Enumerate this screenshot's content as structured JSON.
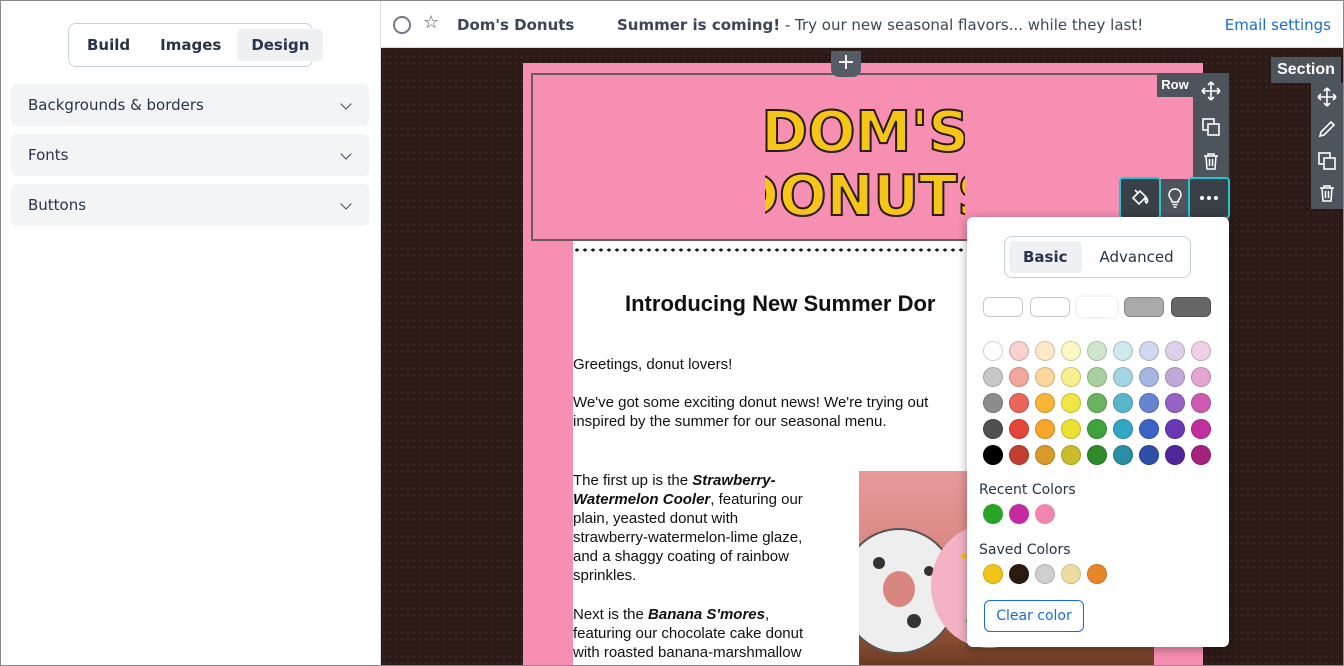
{
  "sidebar": {
    "tabs": [
      {
        "label": "Build",
        "active": false
      },
      {
        "label": "Images",
        "active": false
      },
      {
        "label": "Design",
        "active": true
      }
    ],
    "sections": [
      {
        "label": "Backgrounds & borders",
        "icon": "chevron-down-icon"
      },
      {
        "label": "Fonts",
        "icon": "chevron-down-icon"
      },
      {
        "label": "Buttons",
        "icon": "chevron-down-icon"
      }
    ]
  },
  "topbar": {
    "name": "Dom's Donuts",
    "subject_bold": "Summer is coming!",
    "subject_rest": " - Try our new seasonal flavors... while they last!",
    "email_settings": "Email settings"
  },
  "email": {
    "logo_line1": "DOM'S",
    "logo_line2": "DONUTS",
    "title": "Introducing New Summer Dor",
    "greeting": "Greetings, donut lovers!",
    "intro_line1": "We've got some exciting donut news! We're trying out",
    "intro_line2": "inspired by the summer for our seasonal menu.",
    "p1_pre": "The first up is the ",
    "p1_bold_a": "Strawberry-",
    "p1_bold_b": "Watermelon Cooler",
    "p1_rest_a": ", featuring our",
    "p1_line3": "plain, yeasted donut with",
    "p1_line4": "strawberry-watermelon-lime glaze,",
    "p1_line5": "and a shaggy coating of rainbow",
    "p1_line6": "sprinkles.",
    "p2_pre": "Next is the ",
    "p2_bold": "Banana S'mores",
    "p2_rest": ",",
    "p2_line2": "featuring our chocolate cake donut",
    "p2_line3": "with roasted banana-marshmallow"
  },
  "toolbars": {
    "row_label": "Row",
    "section_label": "Section"
  },
  "color_picker": {
    "tabs": [
      {
        "label": "Basic",
        "active": true
      },
      {
        "label": "Advanced",
        "active": false
      }
    ],
    "presets": [
      "#ffffff",
      "#ffffff",
      "#ffffff",
      "#aaaaaa",
      "#666666"
    ],
    "grid": [
      [
        "#ffffff",
        "#f8d0cc",
        "#fde9c8",
        "#fcf7c6",
        "#cfe6cc",
        "#cfe9ef",
        "#cfd8ef",
        "#ddd0ea",
        "#f0d0e6"
      ],
      [
        "#c8c8c8",
        "#f2a79c",
        "#fbd79c",
        "#f7f08e",
        "#a7d19e",
        "#a2d6e2",
        "#a5b6e2",
        "#c2a8d8",
        "#e2a6d0"
      ],
      [
        "#8c8c8c",
        "#e9665a",
        "#f8b437",
        "#f0e644",
        "#69b45f",
        "#5ab6cc",
        "#6584d2",
        "#9463c4",
        "#cf5bb0"
      ],
      [
        "#505050",
        "#e34536",
        "#f6a72a",
        "#ece033",
        "#3ea33a",
        "#32a7c4",
        "#3b63c7",
        "#6b37b5",
        "#c1309a"
      ],
      [
        "#000000",
        "#c13f30",
        "#d89a2a",
        "#c9bd2c",
        "#2f8a2c",
        "#2a8ea6",
        "#2e4fa7",
        "#53279a",
        "#a5237f"
      ]
    ],
    "recent_label": "Recent Colors",
    "recent": [
      "#28a428",
      "#c52ba1",
      "#ef86ae"
    ],
    "saved_label": "Saved Colors",
    "saved": [
      "#f0c419",
      "#2a1a10",
      "#cfcfcf",
      "#eedba0",
      "#e8862a"
    ],
    "clear_label": "Clear color"
  }
}
